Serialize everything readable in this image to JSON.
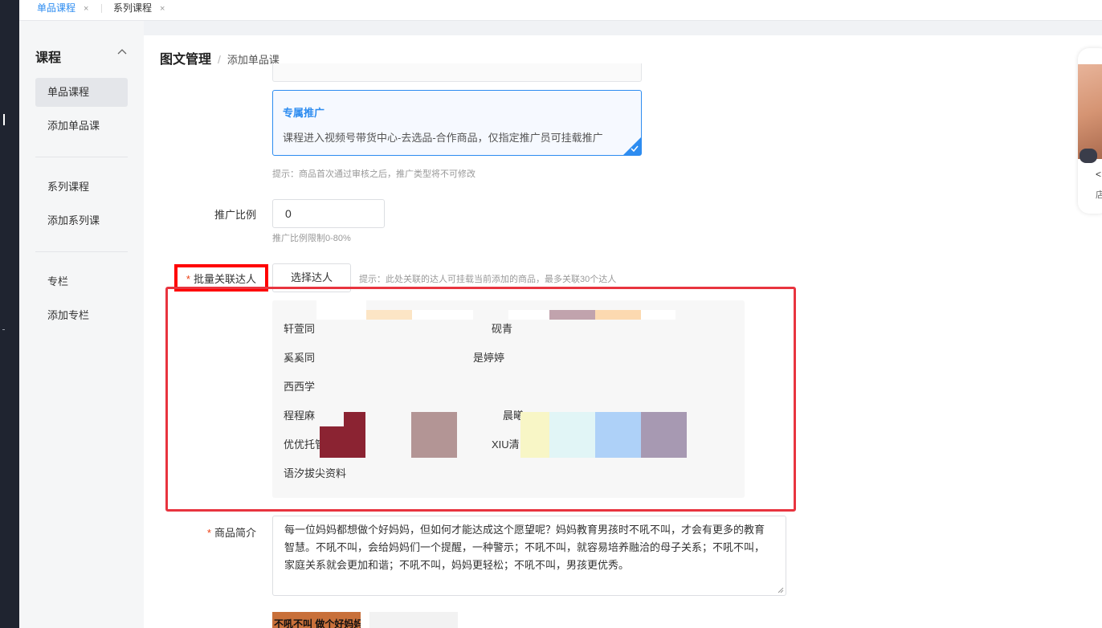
{
  "tabs": [
    {
      "label": "单品课程",
      "close": "×"
    },
    {
      "label": "系列课程",
      "close": "×"
    }
  ],
  "sidebar": {
    "title": "课程",
    "items": [
      {
        "label": "单品课程"
      },
      {
        "label": "添加单品课"
      },
      {
        "label": "系列课程"
      },
      {
        "label": "添加系列课"
      },
      {
        "label": "专栏"
      },
      {
        "label": "添加专栏"
      }
    ]
  },
  "breadcrumb": {
    "root": "图文管理",
    "separator": "/",
    "current": "添加单品课"
  },
  "promotion": {
    "title": "专属推广",
    "desc": "课程进入视频号带货中心-去选品-合作商品，仅指定推广员可挂载推广",
    "hint": "提示：商品首次通过审核之后，推广类型将不可修改"
  },
  "ratio": {
    "label": "推广比例",
    "value": "0",
    "hint": "推广比例限制0-80%"
  },
  "talents": {
    "required_mark": "*",
    "label": "批量关联达人",
    "button": "选择达人",
    "hint": "提示：此处关联的达人可挂载当前添加的商品，最多关联30个达人",
    "names": [
      "轩萱同",
      "砚青",
      "奚奚同",
      "是婷婷",
      "西西学",
      "程程麻",
      "晨曦",
      "优优托管资料",
      "XIU清",
      "语汐拔尖资料"
    ]
  },
  "description": {
    "required_mark": "*",
    "label": "商品简介",
    "value": "每一位妈妈都想做个好妈妈，但如何才能达成这个愿望呢？妈妈教育男孩时不吼不叫，才会有更多的教育智慧。不吼不叫，会给妈妈们一个提醒，一种警示；不吼不叫，就容易培养融洽的母子关系；不吼不叫，家庭关系就会更加和谐；不吼不叫，妈妈更轻松；不吼不叫，男孩更优秀。"
  },
  "thumbnail": {
    "text": "不吼不叫 做个好妈妈"
  },
  "preview": {
    "line1": "<",
    "line2": "店"
  },
  "colors": {
    "accent": "#2d8cf0",
    "required": "#ed4014",
    "highlight": "#ff0000"
  }
}
